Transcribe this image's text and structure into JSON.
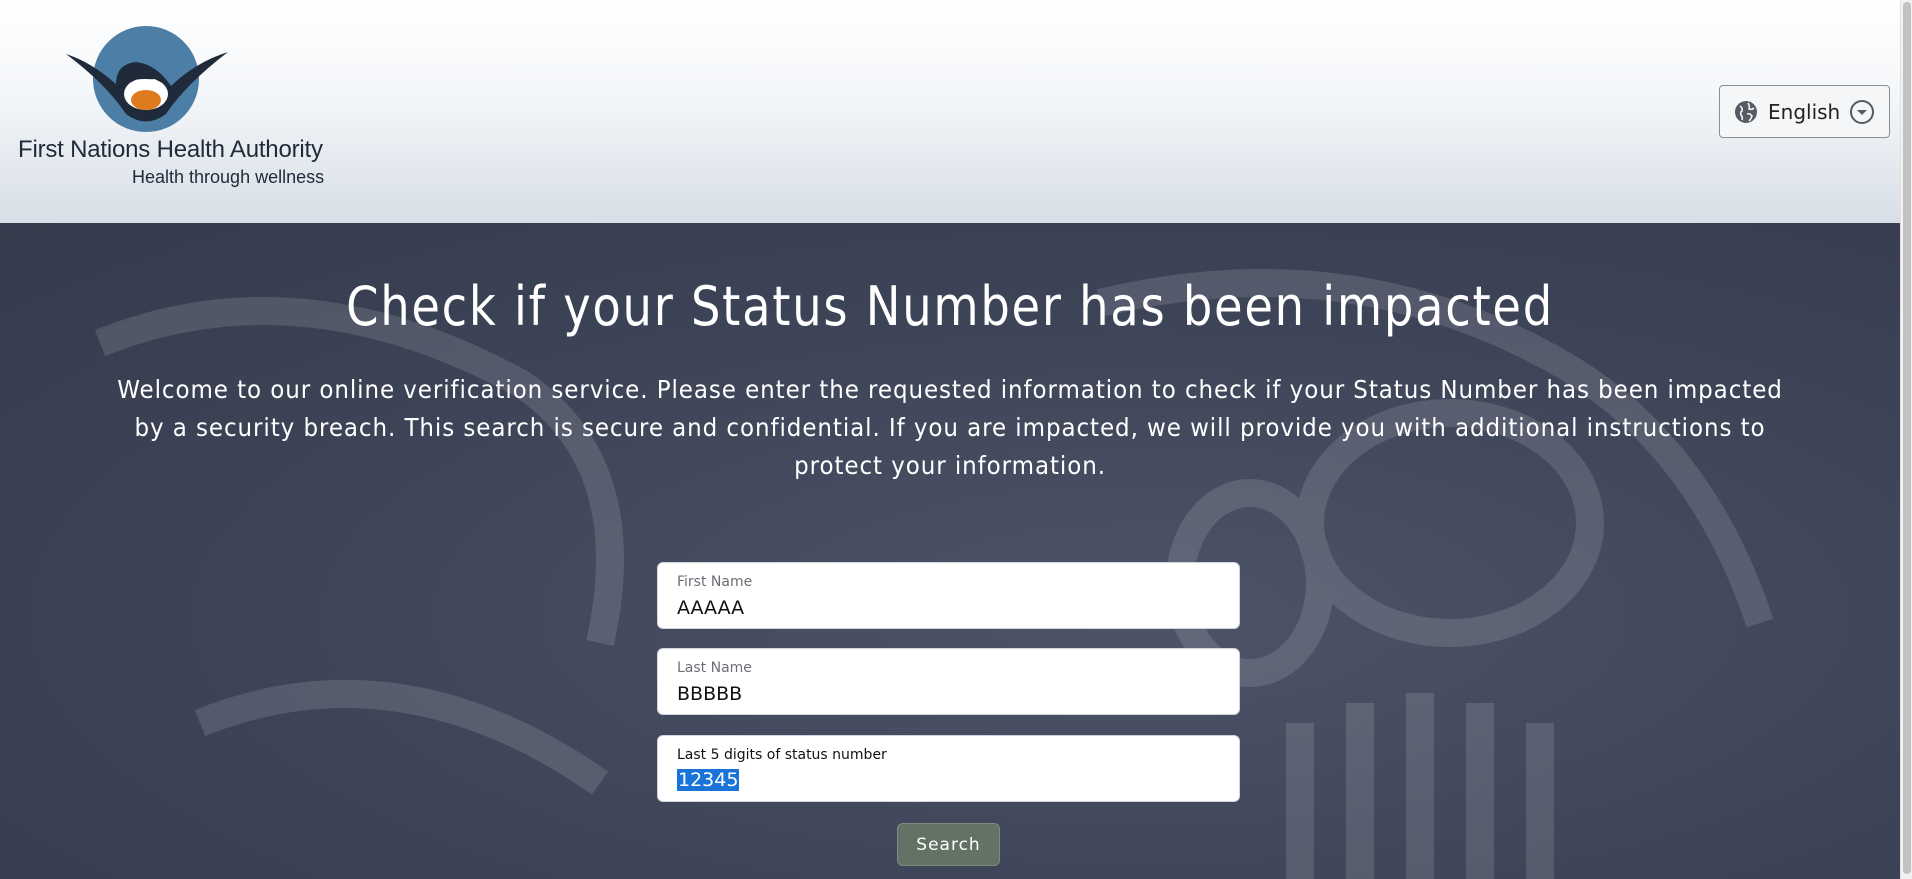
{
  "header": {
    "logo": {
      "title": "First Nations Health Authority",
      "tagline": "Health through wellness",
      "icon": "fnha-logo-mark",
      "colors": {
        "navy": "#1f2b3a",
        "blue": "#4d7fa6",
        "orange": "#e07a1f"
      }
    },
    "language": {
      "label": "English",
      "icon": "globe-icon",
      "chevron": "chevron-down-circle-icon"
    }
  },
  "hero": {
    "title": "Check if your Status Number has been impacted",
    "description": "Welcome to our online verification service. Please enter the requested information to check if your Status Number has been impacted by a security breach. This search is secure and confidential. If you are impacted, we will provide you with additional instructions to protect your information."
  },
  "form": {
    "first_name": {
      "label": "First Name",
      "value": "AAAAA"
    },
    "last_name": {
      "label": "Last Name",
      "value": "BBBBB"
    },
    "status_digits": {
      "label": "Last 5 digits of status number",
      "value": "12345"
    },
    "search_label": "Search"
  },
  "colors": {
    "hero_bg": "#3d4457",
    "button_bg": "#627265",
    "selection": "#1a73d9"
  }
}
